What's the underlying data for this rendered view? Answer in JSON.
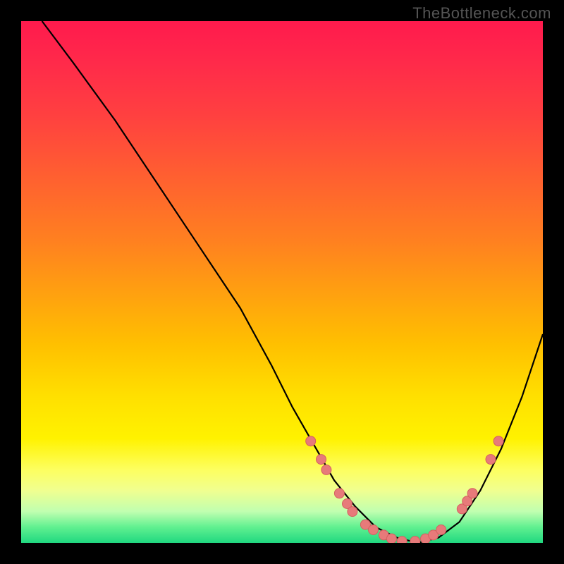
{
  "watermark": "TheBottleneck.com",
  "chart_data": {
    "type": "line",
    "title": "",
    "xlabel": "",
    "ylabel": "",
    "xlim": [
      0,
      100
    ],
    "ylim": [
      0,
      100
    ],
    "series": [
      {
        "name": "curve",
        "x": [
          4,
          10,
          18,
          26,
          34,
          42,
          48,
          52,
          56,
          60,
          64,
          68,
          72,
          76,
          80,
          84,
          88,
          92,
          96,
          100
        ],
        "y": [
          100,
          92,
          81,
          69,
          57,
          45,
          34,
          26,
          19,
          12,
          7,
          3,
          1,
          0,
          1,
          4,
          10,
          18,
          28,
          40
        ]
      }
    ],
    "points": [
      {
        "x": 55.5,
        "y": 19.5
      },
      {
        "x": 57.5,
        "y": 16.0
      },
      {
        "x": 58.5,
        "y": 14.0
      },
      {
        "x": 61.0,
        "y": 9.5
      },
      {
        "x": 62.5,
        "y": 7.5
      },
      {
        "x": 63.5,
        "y": 6.0
      },
      {
        "x": 66.0,
        "y": 3.5
      },
      {
        "x": 67.5,
        "y": 2.5
      },
      {
        "x": 69.5,
        "y": 1.5
      },
      {
        "x": 71.0,
        "y": 0.8
      },
      {
        "x": 73.0,
        "y": 0.3
      },
      {
        "x": 75.5,
        "y": 0.3
      },
      {
        "x": 77.5,
        "y": 0.8
      },
      {
        "x": 79.0,
        "y": 1.5
      },
      {
        "x": 80.5,
        "y": 2.5
      },
      {
        "x": 84.5,
        "y": 6.5
      },
      {
        "x": 85.5,
        "y": 8.0
      },
      {
        "x": 86.5,
        "y": 9.5
      },
      {
        "x": 90.0,
        "y": 16.0
      },
      {
        "x": 91.5,
        "y": 19.5
      }
    ],
    "point_style": {
      "fill": "#e77a7a",
      "stroke": "#d46060",
      "r": 7
    }
  }
}
